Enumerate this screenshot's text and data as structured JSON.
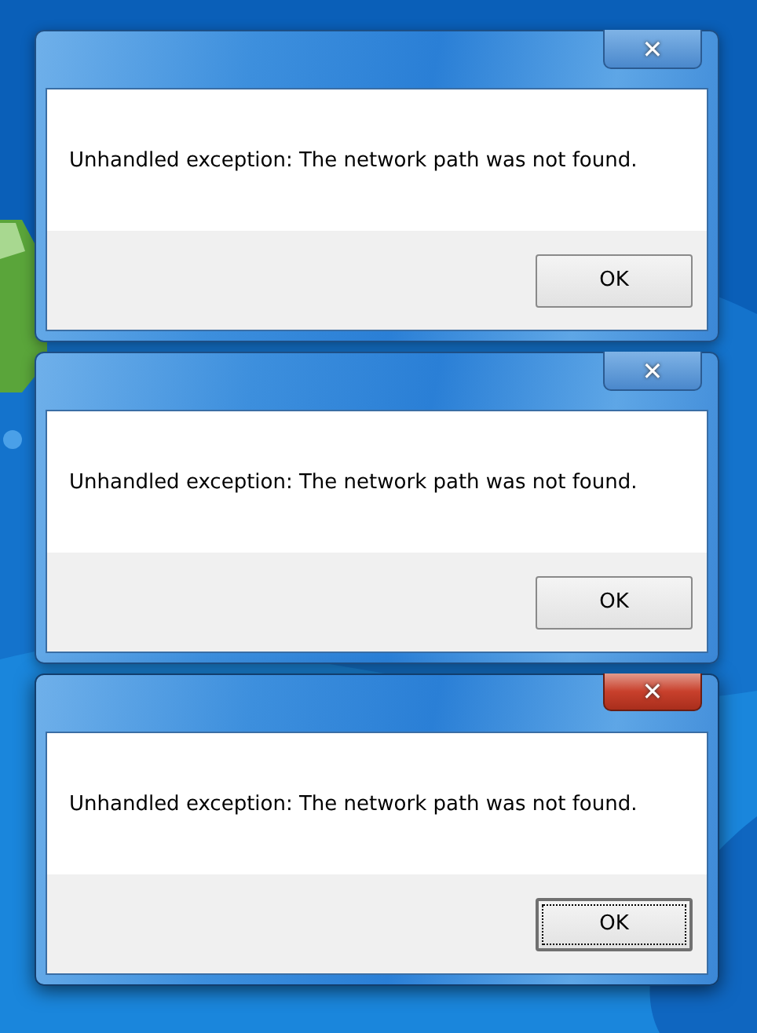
{
  "dialogs": [
    {
      "message": "Unhandled exception: The network path was not found.",
      "close_button": "✕",
      "active": false,
      "ok_button": {
        "label": "OK",
        "focused": false
      }
    },
    {
      "message": "Unhandled exception: The network path was not found.",
      "close_button": "✕",
      "active": false,
      "ok_button": {
        "label": "OK",
        "focused": false
      }
    },
    {
      "message": "Unhandled exception: The network path was not found.",
      "close_button": "✕",
      "active": true,
      "ok_button": {
        "label": "OK",
        "focused": true
      }
    }
  ]
}
